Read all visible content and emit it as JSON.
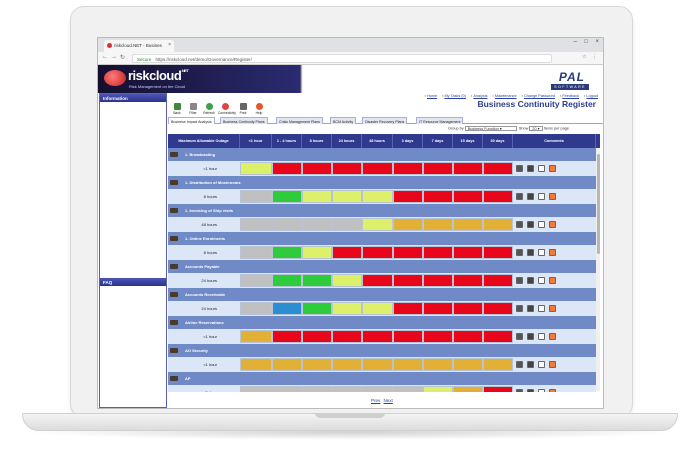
{
  "browser": {
    "tab_title": "riskcloud.NET - Busines",
    "url_secure": "Secure",
    "url": "https://riskcloud.net/demo/Governance/Register/"
  },
  "app": {
    "logo": "riskcloud",
    "logo_sup": ".NET",
    "tagline": "Risk Management on the Cloud",
    "vendor_logo": "PAL",
    "vendor_sub": "SOFTWARE"
  },
  "left_panel": {
    "information_title": "Information",
    "faq_title": "FAQ"
  },
  "top_links": [
    "Home",
    "My Tasks (0)",
    "Analysis",
    "Maintenance",
    "Change Password",
    "Feedback",
    "Logout"
  ],
  "page_title": "Business Continuity Register",
  "toolbar": [
    "Back",
    "Filter",
    "Refresh",
    "Connectivity",
    "Print",
    "Help"
  ],
  "sub_tabs": [
    "Business Impact Analysis",
    "Business Continuity Plans",
    "Crisis Management Plans",
    "BCM Activity",
    "Disaster Recovery Plans",
    "IT Resource Management"
  ],
  "group_by": {
    "label": "Group by",
    "value": "Business Function",
    "show_label": "Show",
    "show_value": "20",
    "per_page_label": "Items per page"
  },
  "table": {
    "headers": [
      "Maximum Allowable Outage",
      "<1 hour",
      "1 - 4 hours",
      "8 hours",
      "24 hours",
      "48 hours",
      "3 days",
      "7 days",
      "15 days",
      "30 days",
      "Comments"
    ],
    "rows": [
      {
        "group": "1. Broadcasting",
        "mao": "<1 hour",
        "cells": [
          "yellow",
          "red",
          "red",
          "red",
          "red",
          "red",
          "red",
          "red",
          "red"
        ]
      },
      {
        "group": "1. Distribution of Mushrooms",
        "mao": "8 hours",
        "cells": [
          "grey",
          "green",
          "yellow",
          "yellow",
          "yellow",
          "red",
          "red",
          "red",
          "red"
        ]
      },
      {
        "group": "1. Invoicing of Ship visits",
        "mao": "48 hours",
        "cells": [
          "grey",
          "grey",
          "grey",
          "grey",
          "yellow",
          "orange",
          "orange",
          "orange",
          "orange"
        ]
      },
      {
        "group": "1. Online Enrolments",
        "mao": "8 hours",
        "cells": [
          "grey",
          "green",
          "yellow",
          "red",
          "red",
          "red",
          "red",
          "red",
          "red"
        ]
      },
      {
        "group": "Accounts Payable",
        "mao": "24 hours",
        "cells": [
          "grey",
          "green",
          "green",
          "yellow",
          "red",
          "red",
          "red",
          "red",
          "red"
        ]
      },
      {
        "group": "Accounts Receivable",
        "mao": "24 hours",
        "cells": [
          "grey",
          "blue",
          "green",
          "yellow",
          "yellow",
          "red",
          "red",
          "red",
          "red"
        ]
      },
      {
        "group": "Airline Reservations",
        "mao": "<1 hour",
        "cells": [
          "orange",
          "red",
          "red",
          "red",
          "red",
          "red",
          "red",
          "red",
          "red"
        ]
      },
      {
        "group": "AO Security",
        "mao": "<1 hour",
        "cells": [
          "orange",
          "orange",
          "orange",
          "orange",
          "orange",
          "orange",
          "orange",
          "orange",
          "orange"
        ]
      },
      {
        "group": "AP",
        "mao": "7 days",
        "cells": [
          "grey",
          "grey",
          "grey",
          "grey",
          "grey",
          "grey",
          "yellow",
          "orange",
          "red"
        ]
      }
    ]
  },
  "pager": {
    "prev": "Prev",
    "next": "Next"
  },
  "colors": {
    "green": "#2ecb3a",
    "yellow": "#dcf06a",
    "red": "#e8071a",
    "orange": "#e2b035",
    "grey": "#c0c0c0",
    "blue": "#2a8fd0",
    "header_blue": "#2f3a8e",
    "group_blue": "#6f8ac6"
  }
}
